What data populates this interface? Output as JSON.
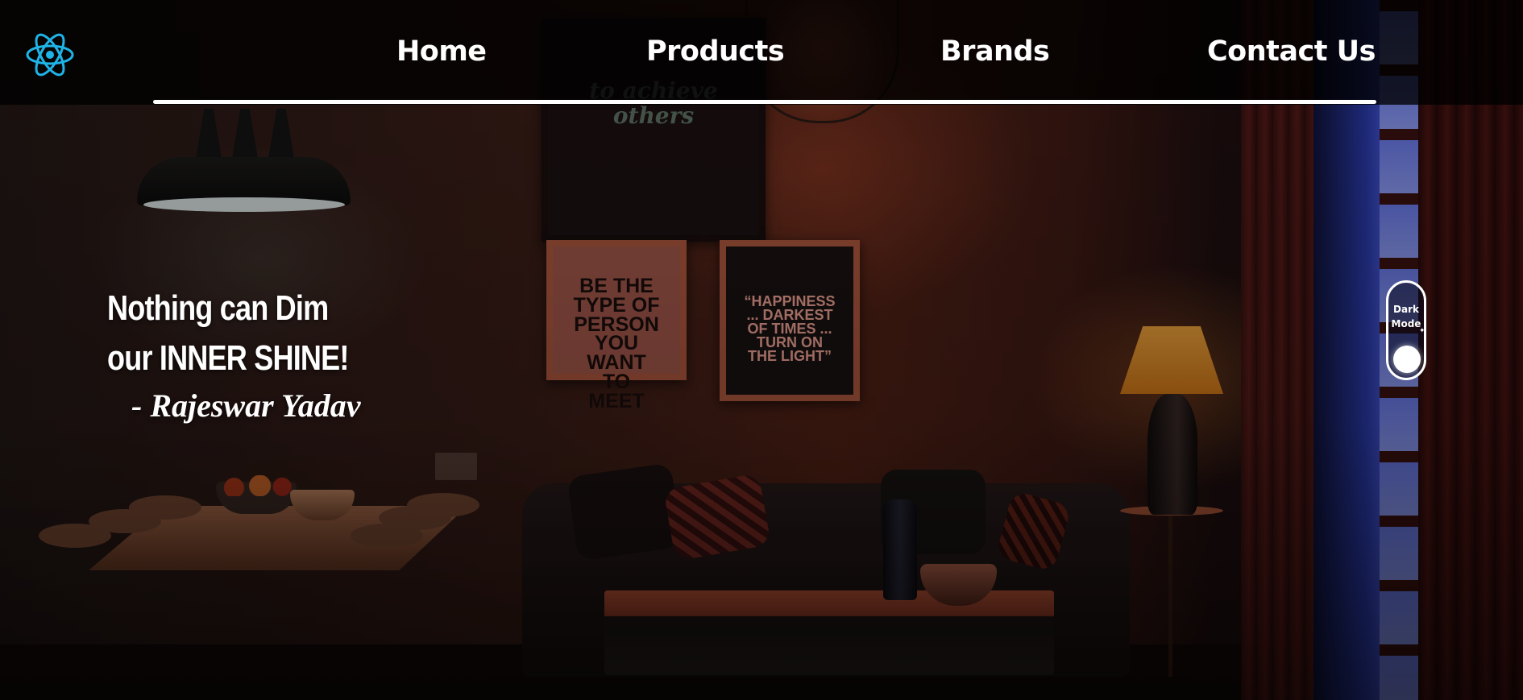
{
  "navbar": {
    "logo_icon": "react-atom-icon",
    "logo_color": "#1fb4e8",
    "links": [
      {
        "label": "Home"
      },
      {
        "label": "Products"
      },
      {
        "label": "Brands"
      },
      {
        "label": "Contact Us"
      }
    ]
  },
  "hero": {
    "quote_line1": "Nothing can Dim",
    "quote_line2": "our INNER SHINE!",
    "author": "- Rajeswar Yadav"
  },
  "artwork": {
    "left_poster": "BE THE TYPE OF PERSON YOU WANT TO MEET",
    "right_poster": "“HAPPINESS ... DARKEST OF TIMES ... TURN ON THE LIGHT”"
  },
  "theme_toggle": {
    "label": "Dark Mode",
    "state": "dark"
  }
}
